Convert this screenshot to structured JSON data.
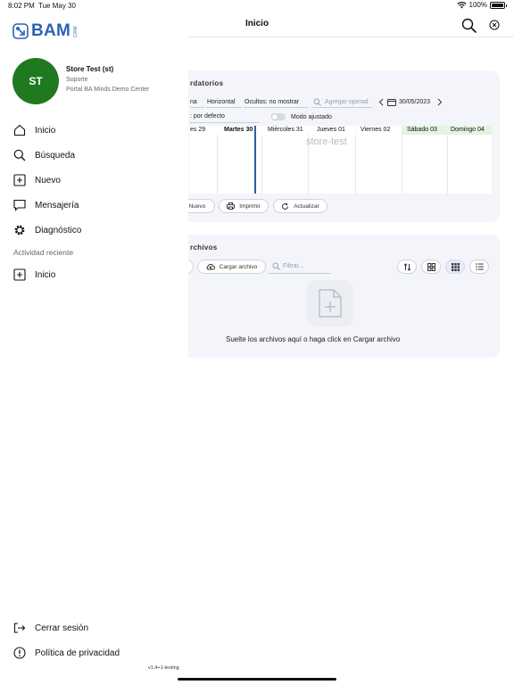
{
  "status_bar": {
    "time": "8:02 PM",
    "date": "Tue May 30",
    "battery": "100%"
  },
  "topnav": {
    "title": "Inicio"
  },
  "drawer": {
    "logo_text": "BAM",
    "logo_sub": "CRM",
    "user": {
      "initials": "ST",
      "name": "Store Test (st)",
      "role": "Soporte",
      "portal": "Portal BA Minds Demo Center"
    },
    "menu": [
      {
        "label": "Inicio",
        "icon": "home-icon"
      },
      {
        "label": "Búsqueda",
        "icon": "search-icon"
      },
      {
        "label": "Nuevo",
        "icon": "plus-square-icon"
      },
      {
        "label": "Mensajería",
        "icon": "chat-icon"
      },
      {
        "label": "Diagnóstico",
        "icon": "gear-icon"
      }
    ],
    "recent_label": "Actividad reciente",
    "recent": [
      {
        "label": "Inicio",
        "icon": "plus-square-icon"
      }
    ],
    "logout": "Cerrar sesión",
    "privacy": "Política de privacidad",
    "version": "v1.4+1-testing"
  },
  "calendar_card": {
    "title": "rdatorios",
    "view_partial": "na",
    "orientation": "Horizontal",
    "hidden": "Ocultos: no mostrar",
    "add_placeholder": "Agregar operad",
    "date": "30/05/2023",
    "default_filter": ": por defecto",
    "adjusted_mode": "Modo ajustado",
    "days": [
      {
        "label": "es 29",
        "weekend": false,
        "bold": false
      },
      {
        "label": "Martes 30",
        "weekend": false,
        "bold": true
      },
      {
        "label": "Miércoles 31",
        "weekend": false,
        "bold": false
      },
      {
        "label": "Jueves 01",
        "weekend": false,
        "bold": false
      },
      {
        "label": "Viernes 02",
        "weekend": false,
        "bold": false
      },
      {
        "label": "Sábado 03",
        "weekend": true,
        "bold": false
      },
      {
        "label": "Domingo 04",
        "weekend": true,
        "bold": false
      }
    ],
    "watermark": "store-test",
    "buttons": {
      "new": "Nuevo",
      "print": "Imprimir",
      "refresh": "Actualizar"
    }
  },
  "files_card": {
    "title": "rchivos",
    "upload": "Cargar archivo",
    "filter_placeholder": "Filtrar...",
    "drop_text": "Suelte los archivos aquí o haga click en Cargar archivo"
  },
  "colors": {
    "brand": "#2b63b5",
    "avatar": "#1f7a1f",
    "weekend_header": "#e3f4e1",
    "now_line": "#2a5caa"
  }
}
